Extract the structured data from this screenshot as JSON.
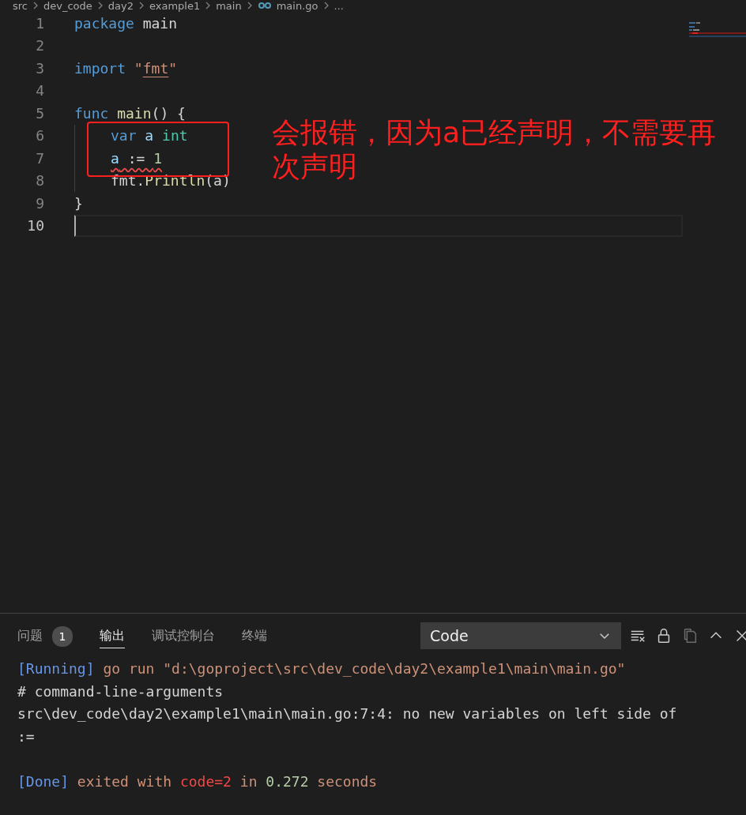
{
  "breadcrumb": [
    "src",
    "dev_code",
    "day2",
    "example1",
    "main",
    "main.go",
    "..."
  ],
  "editor": {
    "lines": [
      {
        "number": "1",
        "current": false,
        "tokens": [
          {
            "text": "package",
            "kind": "keyword"
          },
          {
            "text": " main",
            "kind": "plain"
          }
        ]
      },
      {
        "number": "2",
        "current": false
      },
      {
        "number": "3",
        "current": false,
        "tokens": [
          {
            "text": "import",
            "kind": "keyword"
          },
          {
            "text": " \"",
            "kind": "string"
          },
          {
            "text": "fmt",
            "kind": "string",
            "underline": true
          },
          {
            "text": "\"",
            "kind": "string"
          }
        ]
      },
      {
        "number": "4",
        "current": false
      },
      {
        "number": "5",
        "current": false,
        "tokens": [
          {
            "text": "func",
            "kind": "keyword"
          },
          {
            "text": " main",
            "kind": "function"
          },
          {
            "text": "() {",
            "kind": "plain"
          }
        ]
      },
      {
        "number": "6",
        "current": false,
        "indent": true,
        "tokens": [
          {
            "text": "var",
            "kind": "keyword"
          },
          {
            "text": " a",
            "kind": "variable"
          },
          {
            "text": " int",
            "kind": "type"
          }
        ]
      },
      {
        "number": "7",
        "current": false,
        "indent": true,
        "error": true,
        "tokens": [
          {
            "text": "a",
            "kind": "variable"
          },
          {
            "text": " := ",
            "kind": "plain"
          },
          {
            "text": "1",
            "kind": "number"
          }
        ]
      },
      {
        "number": "8",
        "current": false,
        "indent": true,
        "tokens": [
          {
            "text": "fmt.",
            "kind": "plain"
          },
          {
            "text": "Println",
            "kind": "function"
          },
          {
            "text": "(a)",
            "kind": "plain"
          }
        ]
      },
      {
        "number": "9",
        "current": false,
        "tokens": [
          {
            "text": "}",
            "kind": "plain"
          }
        ]
      },
      {
        "number": "10",
        "current": true
      }
    ]
  },
  "annotation": {
    "text": "会报错，因为a已经声明，不需要再次声明",
    "color": "#ff1f1f"
  },
  "panel": {
    "tabs": [
      {
        "label": "问题",
        "badge": "1",
        "selected": false
      },
      {
        "label": "输出",
        "selected": true
      },
      {
        "label": "调试控制台",
        "selected": false
      },
      {
        "label": "终端",
        "selected": false
      }
    ],
    "channel": "Code",
    "output": [
      {
        "segments": [
          {
            "text": "[Running]",
            "kind": "tag"
          },
          {
            "text": " go run \"d:\\goproject\\src\\dev_code\\day2\\example1\\main\\main.go\"",
            "kind": "info"
          }
        ]
      },
      {
        "segments": [
          {
            "text": "# command-line-arguments",
            "kind": "plain"
          }
        ]
      },
      {
        "segments": [
          {
            "text": "src\\dev_code\\day2\\example1\\main\\main.go:7:4: no new variables on left side of",
            "kind": "plain"
          }
        ]
      },
      {
        "segments": [
          {
            "text": ":=",
            "kind": "plain"
          }
        ]
      },
      {
        "gap_before": true,
        "segments": [
          {
            "text": "[Done]",
            "kind": "tag"
          },
          {
            "text": " exited with ",
            "kind": "info"
          },
          {
            "text": "code=2",
            "kind": "error"
          },
          {
            "text": " in ",
            "kind": "info"
          },
          {
            "text": "0.272",
            "kind": "number"
          },
          {
            "text": " seconds",
            "kind": "info"
          }
        ]
      }
    ]
  }
}
